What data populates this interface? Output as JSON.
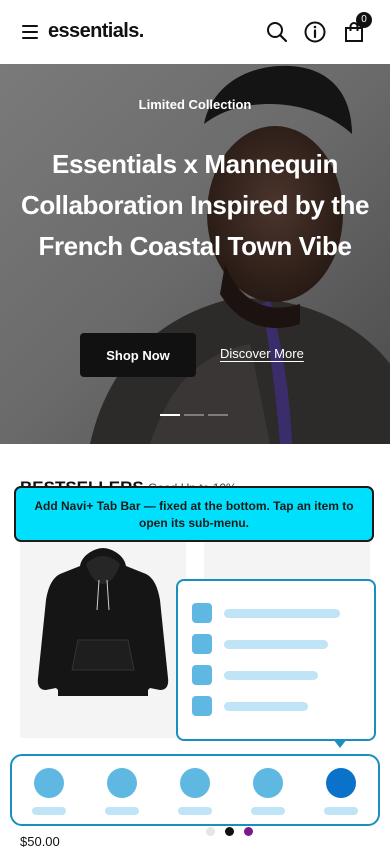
{
  "header": {
    "logo": "essentials.",
    "icons": [
      "menu-icon",
      "search-icon",
      "info-icon",
      "bag-icon"
    ],
    "cart_count": "0"
  },
  "hero": {
    "eyebrow": "Limited Collection",
    "title": "Essentials x Mannequin Collaboration Inspired by the French Coastal Town Vibe",
    "primary_button": "Shop Now",
    "secondary_link": "Discover More",
    "slide_count": 3,
    "active_slide": 1
  },
  "bestsellers": {
    "title": "BESTSELLERS",
    "subtitle": "Good Up to 10%",
    "price": "$50.00",
    "carousel_dot_colors": [
      "#e6e6e6",
      "#111111",
      "#7a1a8a"
    ]
  },
  "overlay": {
    "callout": "Add Navi+ Tab Bar — fixed at the bottom. Tap an item to open its sub-menu.",
    "submenu_item_count": 4,
    "tab_count": 5,
    "active_tab": 5
  },
  "colors": {
    "callout_bg": "#00e0fc",
    "accent_border": "#1a8fbf",
    "icon_light": "#5eb8e2",
    "icon_active": "#0a72c9",
    "placeholder": "#bfe4f5"
  }
}
